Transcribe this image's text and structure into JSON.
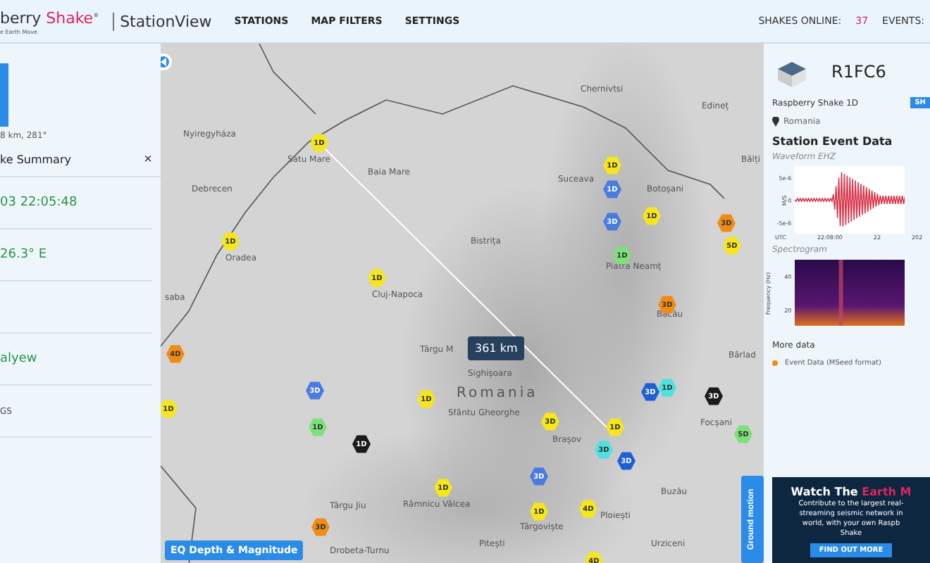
{
  "header": {
    "logo_lead": "berry",
    "logo_brand": "Shake",
    "logo_mark": "®",
    "logo_tagline": "e Earth Move",
    "app_name": "StationView",
    "nav": [
      {
        "label": "STATIONS"
      },
      {
        "label": "MAP FILTERS"
      },
      {
        "label": "SETTINGS"
      }
    ],
    "stats_label": "SHAKES ONLINE:",
    "stats_count": "37",
    "events_label": "EVENTS:"
  },
  "summary": {
    "distance": "8 km, 281°",
    "title": "ke Summary",
    "close": "×",
    "rows": [
      {
        "value": "03 22:05:48",
        "kind": "green"
      },
      {
        "value": "26.3° E",
        "kind": "green"
      },
      {
        "value": "",
        "kind": "blank"
      },
      {
        "value": "alyew",
        "kind": "green"
      },
      {
        "value": "GS",
        "kind": "plain"
      }
    ]
  },
  "map": {
    "labels": [
      "Nyiregyháza",
      "Debrecen",
      "Satu Mare",
      "Baia Mare",
      "Oradea",
      "saba",
      "Cluj-Napoca",
      "Bistrița",
      "Târgu M",
      "Chernivtsi",
      "Edineț",
      "Bălți",
      "Botoșani",
      "Suceava",
      "Piatra Neamț",
      "Bacău",
      "Bârlad",
      "Sighișoara",
      "Romania",
      "Sfântu Gheorghe",
      "Focșani",
      "Brașov",
      "Buzău",
      "Târgu Jiu",
      "Râmnicu Vâlcea",
      "Târgoviște",
      "Ploiești",
      "Pitești",
      "Urziceni",
      "Drobeta-Turnu"
    ],
    "markers": [
      {
        "label": "1D",
        "color": "#f5e61e"
      },
      {
        "label": "1D",
        "color": "#f5e61e"
      },
      {
        "label": "1D",
        "color": "#f5e61e"
      },
      {
        "label": "4D",
        "color": "#f08c14"
      },
      {
        "label": "1D",
        "color": "#f5e61e"
      },
      {
        "label": "3D",
        "color": "#4a7be0"
      },
      {
        "label": "1D",
        "color": "#7ee07a"
      },
      {
        "label": "1D",
        "color": "#1a1a1a"
      },
      {
        "label": "1D",
        "color": "#f5e61e"
      },
      {
        "label": "1D",
        "color": "#f5e61e"
      },
      {
        "label": "3D",
        "color": "#f08c14"
      },
      {
        "label": "1D",
        "color": "#f5e61e"
      },
      {
        "label": "1D",
        "color": "#4a7be0"
      },
      {
        "label": "3D",
        "color": "#4a7be0"
      },
      {
        "label": "1D",
        "color": "#f5e61e"
      },
      {
        "label": "1D",
        "color": "#7ee07a"
      },
      {
        "label": "3D",
        "color": "#f08c14"
      },
      {
        "label": "5D",
        "color": "#f5e61e"
      },
      {
        "label": "3D",
        "color": "#f08c14"
      },
      {
        "label": "3D",
        "color": "#1f5fd6"
      },
      {
        "label": "1D",
        "color": "#4fe0e0"
      },
      {
        "label": "3D",
        "color": "#1a1a1a"
      },
      {
        "label": "3D",
        "color": "#f5e61e"
      },
      {
        "label": "1D",
        "color": "#f5e61e"
      },
      {
        "label": "3D",
        "color": "#4fe0e0"
      },
      {
        "label": "3D",
        "color": "#1f5fd6"
      },
      {
        "label": "3D",
        "color": "#4a7be0"
      },
      {
        "label": "1D",
        "color": "#f5e61e"
      },
      {
        "label": "4D",
        "color": "#f5e61e"
      },
      {
        "label": "4D",
        "color": "#f5e61e"
      },
      {
        "label": "5D",
        "color": "#7ee07a"
      }
    ],
    "distance": "361 km",
    "depth_button": "EQ Depth & Magnitude",
    "ground_button": "Ground motion"
  },
  "station": {
    "code": "R1FC6",
    "model": "Raspberry Shake 1D",
    "badge": "SH",
    "location": "Romania",
    "section_title": "Station Event Data",
    "waveform_title": "Waveform EHZ",
    "waveform_yticks": [
      "5e-6",
      "0",
      "-5e-6"
    ],
    "waveform_ylabel": "M/S",
    "waveform_tz": "UTC",
    "waveform_xticks": [
      "22:08:00",
      "22"
    ],
    "waveform_xsub": "202",
    "spectrogram_title": "Spectrogram",
    "spectrogram_ylabel": "Frequency (Hz)",
    "spectrogram_yticks": [
      "40",
      "20"
    ],
    "more_title": "More data",
    "more_link": "Event Data (MSeed format)"
  },
  "promo": {
    "title_lead": "Watch The",
    "title_accent": "Earth M",
    "lines": [
      "Contribute to the largest real-",
      "streaming seismic network in",
      "world, with your own Raspb",
      "Shake"
    ],
    "button": "FIND OUT MORE"
  }
}
